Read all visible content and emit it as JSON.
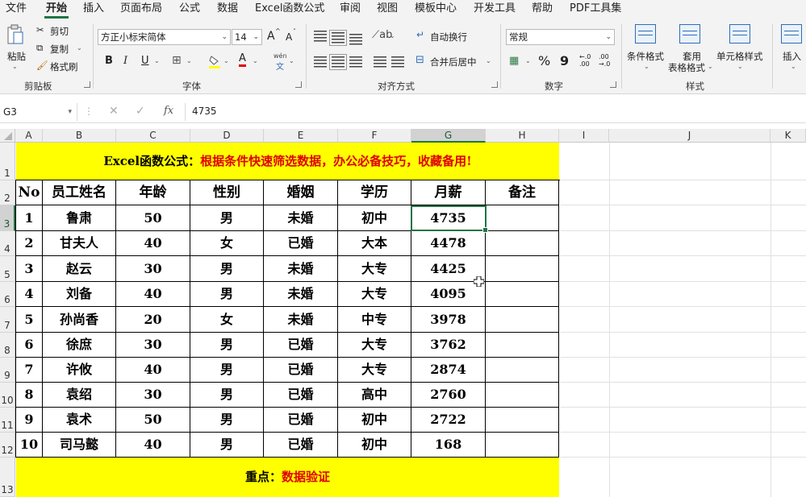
{
  "menu": [
    "文件",
    "开始",
    "插入",
    "页面布局",
    "公式",
    "数据",
    "Excel函数公式",
    "审阅",
    "视图",
    "模板中心",
    "开发工具",
    "帮助",
    "PDF工具集"
  ],
  "ribbon": {
    "clipboard": {
      "paste": "粘贴",
      "cut": "剪切",
      "copy": "复制",
      "format_painter": "格式刷",
      "label": "剪贴板"
    },
    "font": {
      "name": "方正小标宋简体",
      "size": "14",
      "grow": "A",
      "shrink": "A",
      "bold": "B",
      "italic": "I",
      "underline": "U",
      "font_color_letter": "A",
      "phonetic": "wén",
      "phonetic_sub": "文",
      "label": "字体"
    },
    "alignment": {
      "wrap_text": "自动换行",
      "merge_center": "合并后居中",
      "label": "对齐方式"
    },
    "number": {
      "format": "常规",
      "percent": "%",
      "comma": "9",
      "inc_decimal": "←.0 .00",
      "dec_decimal": ".00 →.0",
      "label": "数字"
    },
    "styles": {
      "conditional": "条件格式",
      "table_format_1": "套用",
      "table_format_2": "表格格式",
      "cell_styles": "单元格样式",
      "label": "样式"
    },
    "cells": {
      "insert": "插入"
    }
  },
  "formula_bar": {
    "name_box": "G3",
    "fx": "fx",
    "value": "4735"
  },
  "columns": [
    "A",
    "B",
    "C",
    "D",
    "E",
    "F",
    "G",
    "H",
    "I",
    "J",
    "K"
  ],
  "rows": [
    "1",
    "2",
    "3",
    "4",
    "5",
    "6",
    "7",
    "8",
    "9",
    "10",
    "11",
    "12",
    "13"
  ],
  "sheet": {
    "title_black": "Excel函数公式：",
    "title_red": "根据条件快速筛选数据，办公必备技巧，收藏备用!",
    "headers": [
      "No",
      "员工姓名",
      "年龄",
      "性别",
      "婚姻",
      "学历",
      "月薪",
      "备注"
    ],
    "data": [
      [
        "1",
        "鲁肃",
        "50",
        "男",
        "未婚",
        "初中",
        "4735",
        ""
      ],
      [
        "2",
        "甘夫人",
        "40",
        "女",
        "已婚",
        "大本",
        "4478",
        ""
      ],
      [
        "3",
        "赵云",
        "30",
        "男",
        "未婚",
        "大专",
        "4425",
        ""
      ],
      [
        "4",
        "刘备",
        "40",
        "男",
        "未婚",
        "大专",
        "4095",
        ""
      ],
      [
        "5",
        "孙尚香",
        "20",
        "女",
        "未婚",
        "中专",
        "3978",
        ""
      ],
      [
        "6",
        "徐庶",
        "30",
        "男",
        "已婚",
        "大专",
        "3762",
        ""
      ],
      [
        "7",
        "许攸",
        "40",
        "男",
        "已婚",
        "大专",
        "2874",
        ""
      ],
      [
        "8",
        "袁绍",
        "30",
        "男",
        "已婚",
        "高中",
        "2760",
        ""
      ],
      [
        "9",
        "袁术",
        "50",
        "男",
        "已婚",
        "初中",
        "2722",
        ""
      ],
      [
        "10",
        "司马懿",
        "40",
        "男",
        "已婚",
        "初中",
        "168",
        ""
      ]
    ],
    "footer_black": "重点：",
    "footer_red": "数据验证"
  },
  "colors": {
    "accent": "#217346",
    "banner": "#ffff00",
    "red_text": "#e00000"
  }
}
